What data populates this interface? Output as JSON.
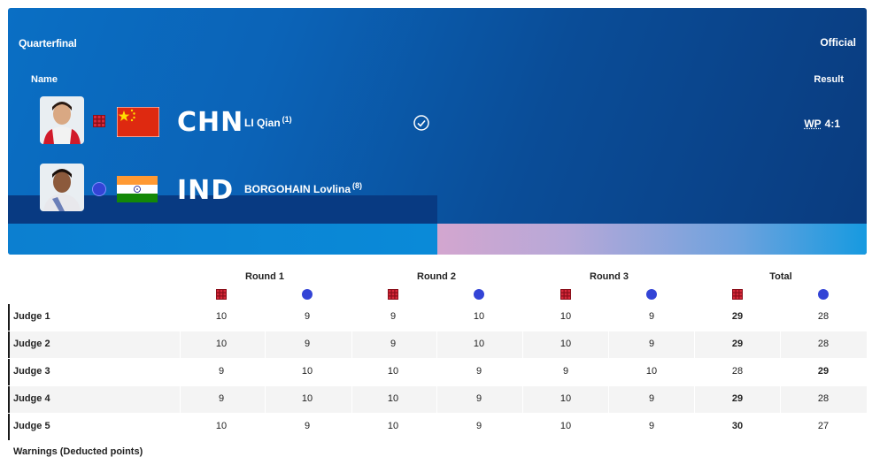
{
  "header": {
    "title": "Quarterfinal",
    "status": "Official",
    "name_col": "Name",
    "result_col": "Result"
  },
  "athletes": [
    {
      "code": "CHN",
      "name": "LI Qian",
      "seed": "(1)",
      "corner": "red",
      "winner": true
    },
    {
      "code": "IND",
      "name": "BORGOHAIN Lovlina",
      "seed": "(8)",
      "corner": "blue",
      "winner": false
    }
  ],
  "result": {
    "method": "WP",
    "score": "4:1"
  },
  "table": {
    "rounds": [
      "Round 1",
      "Round 2",
      "Round 3",
      "Total"
    ],
    "rows": [
      {
        "label": "Judge 1",
        "values": [
          "10",
          "9",
          "9",
          "10",
          "10",
          "9",
          "29",
          "28"
        ],
        "bold": [
          6
        ]
      },
      {
        "label": "Judge 2",
        "values": [
          "10",
          "9",
          "9",
          "10",
          "10",
          "9",
          "29",
          "28"
        ],
        "bold": [
          6
        ]
      },
      {
        "label": "Judge 3",
        "values": [
          "9",
          "10",
          "10",
          "9",
          "9",
          "10",
          "28",
          "29"
        ],
        "bold": [
          7
        ]
      },
      {
        "label": "Judge 4",
        "values": [
          "9",
          "10",
          "10",
          "9",
          "10",
          "9",
          "29",
          "28"
        ],
        "bold": [
          6
        ]
      },
      {
        "label": "Judge 5",
        "values": [
          "10",
          "9",
          "10",
          "9",
          "10",
          "9",
          "30",
          "27"
        ],
        "bold": [
          6
        ]
      }
    ],
    "footer_label": "Warnings (Deducted points)"
  },
  "colors": {
    "red_corner": "#c8102e",
    "blue_corner": "#3344d6",
    "header_blue": "#0a4d98"
  }
}
